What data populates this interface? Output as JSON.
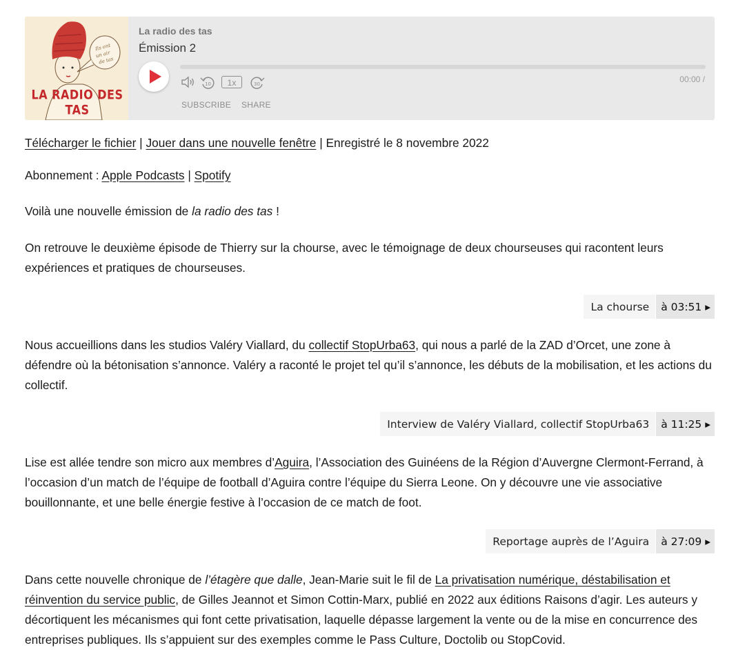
{
  "player": {
    "cover_logo": "LA RADIO DES TAS",
    "podcast_name": "La radio des tas",
    "episode_title": "Émission 2",
    "speed": "1x",
    "time": "00:00 /",
    "subscribe_label": "SUBSCRIBE",
    "share_label": "SHARE",
    "play_color": "#e0303a",
    "background_color": "#e9e9e9"
  },
  "meta_line": {
    "download_link": "Télécharger le fichier",
    "sep1": " | ",
    "new_window_link": "Jouer dans une nouvelle fenêtre",
    "sep2": " | Enregistré le 8 novembre 2022"
  },
  "subscription": {
    "prefix": "Abonnement : ",
    "apple_link": "Apple Podcasts",
    "sep": " | ",
    "spotify_link": "Spotify"
  },
  "intro": {
    "before": "Voilà une nouvelle émission de ",
    "italic": "la radio des tas",
    "after": " !"
  },
  "paragraph_1": "On retrouve le deuxième épisode de Thierry sur la chourse, avec le témoignage de deux chourseuses qui racontent leurs expériences et pratiques de chourseuses.",
  "chapters": [
    {
      "title": "La chourse",
      "time": "à 03:51 ▸"
    },
    {
      "title": "Interview de Valéry Viallard, collectif StopUrba63",
      "time": "à 11:25 ▸"
    },
    {
      "title": "Reportage auprès de l’Aguira",
      "time": "à 27:09 ▸"
    }
  ],
  "paragraph_2": {
    "before": "Nous accueillions dans les studios Valéry Viallard, du ",
    "link": "collectif StopUrba63",
    "after": ", qui nous a parlé de la ZAD d’Orcet, une zone à défendre où la bétonisation s’annonce. Valéry a raconté le projet tel qu’il s’annonce, les débuts de la mobilisation, et les actions du collectif."
  },
  "paragraph_3": {
    "before": "Lise est allée tendre son micro aux membres d’",
    "link": "Aguira",
    "after": ", l’Association des Guinéens de la Région d’Auvergne Clermont-Ferrand, à l’occasion d’un match de l’équipe de football d’Aguira contre l’équipe du Sierra Leone. On y découvre une vie associative bouillonnante, et une belle énergie festive à l’occasion de ce match de foot."
  },
  "paragraph_4": {
    "before": "Dans cette nouvelle chronique de ",
    "italic": "l’étagère que dalle",
    "middle": ", Jean-Marie suit le fil de ",
    "link": "La privatisation numérique, déstabilisation et réinvention du service public",
    "after": ", de Gilles Jeannot et Simon Cottin-Marx, publié en 2022 aux éditions Raisons d’agir. Les auteurs y décortiquent les mécanismes qui font cette privatisation, laquelle dépasse largement la vente ou de la mise en concurrence des entreprises publiques. Ils s’appuient sur des exemples comme le Pass Culture, Doctolib ou StopCovid."
  }
}
